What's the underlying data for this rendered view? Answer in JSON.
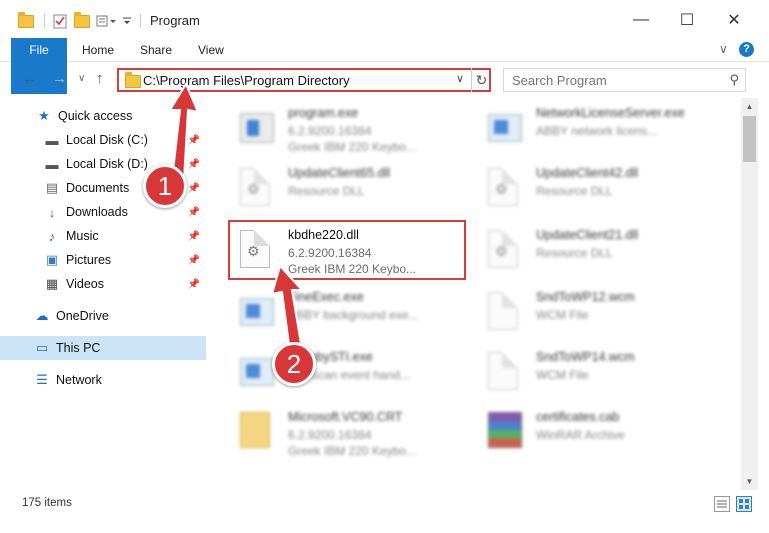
{
  "window": {
    "title": "Program",
    "buttons": {
      "minimize": "—",
      "maximize": "☐",
      "close": "✕"
    }
  },
  "ribbon": {
    "tabs": [
      {
        "label": "File",
        "active": true
      },
      {
        "label": "Home"
      },
      {
        "label": "Share"
      },
      {
        "label": "View"
      }
    ],
    "collapse_glyph": "∨",
    "help_glyph": "?"
  },
  "address": {
    "path": "C:\\Program Files\\Program Directory",
    "search_placeholder": "Search Program"
  },
  "nav": {
    "items": [
      {
        "label": "Quick access",
        "icon": "star-icon",
        "glyph": "★",
        "color": "#1f6fc5"
      },
      {
        "label": "Local Disk (C:)",
        "icon": "drive-icon",
        "glyph": "▬",
        "color": "#555",
        "pinned": true
      },
      {
        "label": "Local Disk (D:)",
        "icon": "drive-icon",
        "glyph": "▬",
        "color": "#555",
        "pinned": true
      },
      {
        "label": "Documents",
        "icon": "documents-icon",
        "glyph": "▤",
        "color": "#666",
        "pinned": true
      },
      {
        "label": "Downloads",
        "icon": "downloads-icon",
        "glyph": "↓",
        "color": "#1f6fc5",
        "pinned": true
      },
      {
        "label": "Music",
        "icon": "music-icon",
        "glyph": "♪",
        "color": "#1f6fc5",
        "pinned": true
      },
      {
        "label": "Pictures",
        "icon": "pictures-icon",
        "glyph": "▣",
        "color": "#3b7bbf",
        "pinned": true
      },
      {
        "label": "Videos",
        "icon": "videos-icon",
        "glyph": "▦",
        "color": "#444",
        "pinned": true
      },
      {
        "label": "OneDrive",
        "icon": "onedrive-icon",
        "glyph": "☁",
        "color": "#1f6fc5"
      },
      {
        "label": "This PC",
        "icon": "computer-icon",
        "glyph": "▭",
        "color": "#1f6fc5",
        "selected": true
      },
      {
        "label": "Network",
        "icon": "network-icon",
        "glyph": "☰",
        "color": "#1f6fc5"
      }
    ]
  },
  "files": [
    {
      "name": "program.exe",
      "line2": "6.2.9200.16384",
      "line3": "Greek IBM 220 Keybo...",
      "icon": "exe-icon",
      "blurred": true
    },
    {
      "name": "NetworkLicenseServer.exe",
      "line2": "ABBY network licens...",
      "line3": "",
      "icon": "app-icon",
      "blurred": true
    },
    {
      "name": "UpdateClient65.dll",
      "line2": "Resource DLL",
      "line3": "",
      "icon": "dll-icon",
      "blurred": true
    },
    {
      "name": "UpdateClient42.dll",
      "line2": "Resource DLL",
      "line3": "",
      "icon": "dll-icon",
      "blurred": true
    },
    {
      "name": "kbdhe220.dll",
      "line2": "6.2.9200.16384",
      "line3": "Greek IBM 220 Keybo...",
      "icon": "dll-icon",
      "blurred": false,
      "highlighted": true
    },
    {
      "name": "UpdateClient21.dll",
      "line2": "Resource DLL",
      "line3": "",
      "icon": "dll-icon",
      "blurred": true
    },
    {
      "name": "FineExec.exe",
      "line2": "ABBY background exe...",
      "line3": "",
      "icon": "app-icon",
      "blurred": true
    },
    {
      "name": "SndToWP12.wcm",
      "line2": "WCM File",
      "line3": "",
      "icon": "doc-icon",
      "blurred": true
    },
    {
      "name": "ScanbySTI.exe",
      "line2": "STI Scan event hand...",
      "line3": "",
      "icon": "app-icon",
      "blurred": true
    },
    {
      "name": "SndToWP14.wcm",
      "line2": "WCM File",
      "line3": "",
      "icon": "doc-icon",
      "blurred": true
    },
    {
      "name": "Microsoft.VC90.CRT",
      "line2": "6.2.9200.16384",
      "line3": "Greek IBM 220 Keybo...",
      "icon": "folder-icon",
      "blurred": true
    },
    {
      "name": "certificates.cab",
      "line2": "WinRAR Archive",
      "line3": "",
      "icon": "archive-icon",
      "blurred": true
    }
  ],
  "status": {
    "item_count": "175 items"
  },
  "annotations": {
    "step1": "1",
    "step2": "2",
    "accent": "#d63c3c"
  }
}
